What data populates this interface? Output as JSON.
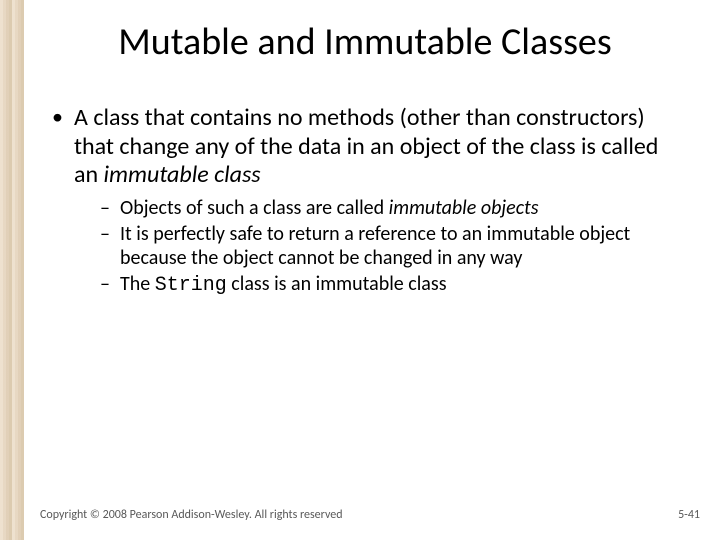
{
  "title": "Mutable and Immutable Classes",
  "bullet1_pre": "A class that contains no methods (other than constructors) that change any of the data in an object of the class is called an ",
  "bullet1_ital": "immutable class",
  "sub1_pre": "Objects of such a class are called ",
  "sub1_ital": "immutable objects",
  "sub2": "It is perfectly safe to return a reference to an immutable object because the object cannot be changed in any way",
  "sub3_pre": "The ",
  "sub3_code": "String",
  "sub3_post": " class is an immutable class",
  "footer_copyright": "Copyright © 2008 Pearson Addison-Wesley. All rights reserved",
  "footer_page": "5-41"
}
